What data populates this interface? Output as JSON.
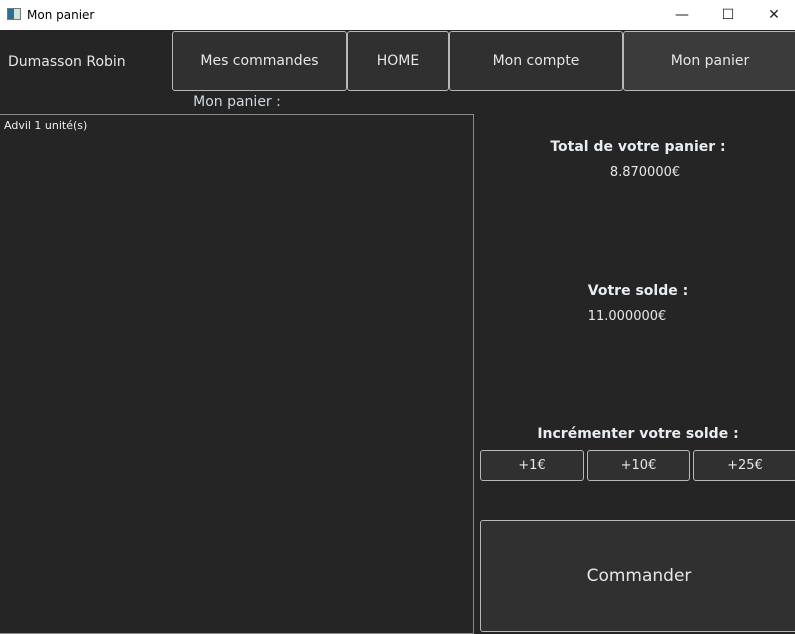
{
  "window": {
    "title": "Mon panier",
    "minimize": "—",
    "maximize": "☐",
    "close": "✕"
  },
  "header": {
    "user": "Dumasson  Robin",
    "nav": [
      "Mes commandes",
      "HOME",
      "Mon compte",
      "Mon panier"
    ]
  },
  "cart": {
    "label": "Mon panier :",
    "items": [
      "Advil 1 unité(s)"
    ]
  },
  "summary": {
    "total_label": "Total de votre panier :",
    "total_value": "8.870000€",
    "balance_label": "Votre solde :",
    "balance_value": "11.000000€",
    "increment_label": "Incrémenter votre solde :",
    "increments": [
      "+1€",
      "+10€",
      "+25€"
    ],
    "order_button": "Commander"
  }
}
